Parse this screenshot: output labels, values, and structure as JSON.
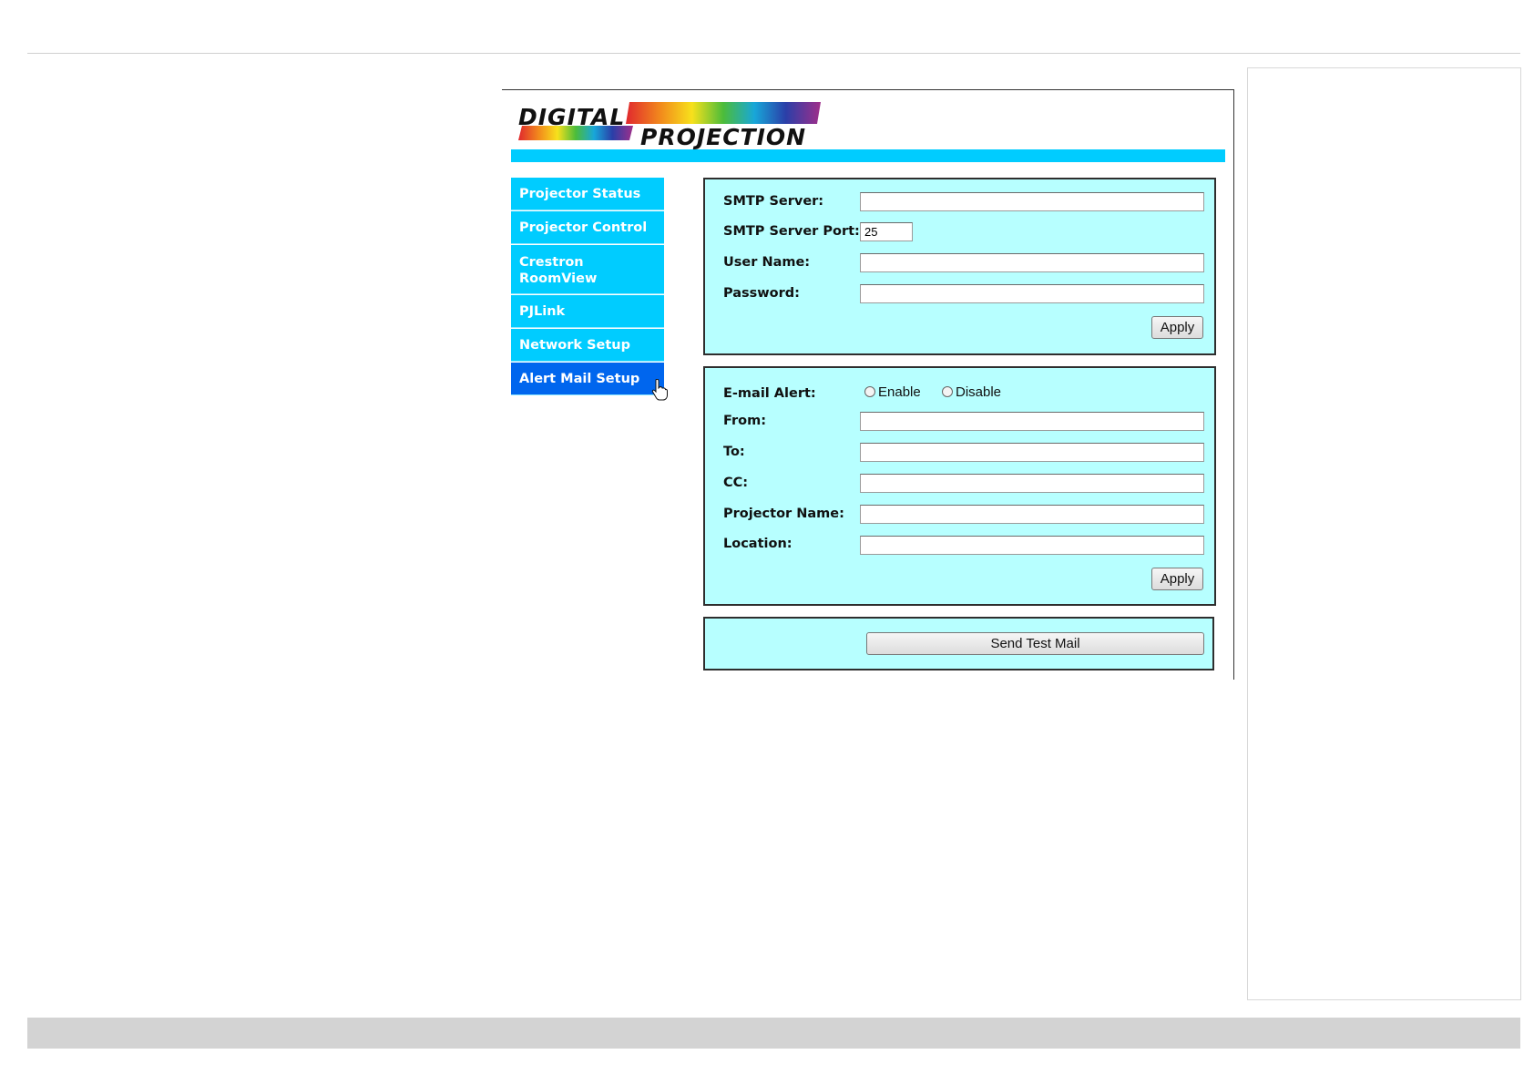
{
  "logo": {
    "line1": "DIGITAL",
    "line2": "PROJECTION"
  },
  "nav": {
    "items": [
      {
        "label": "Projector Status"
      },
      {
        "label": "Projector Control"
      },
      {
        "label": "Crestron RoomView"
      },
      {
        "label": "PJLink"
      },
      {
        "label": "Network Setup"
      },
      {
        "label": "Alert Mail Setup",
        "active": true
      }
    ]
  },
  "smtp": {
    "server_label": "SMTP Server:",
    "server_value": "",
    "port_label": "SMTP Server Port:",
    "port_value": "25",
    "user_label": "User Name:",
    "user_value": "",
    "password_label": "Password:",
    "password_value": "",
    "apply_label": "Apply"
  },
  "alert": {
    "email_alert_label": "E-mail Alert:",
    "enable_label": "Enable",
    "disable_label": "Disable",
    "from_label": "From:",
    "to_label": "To:",
    "cc_label": "CC:",
    "projector_name_label": "Projector Name:",
    "location_label": "Location:",
    "apply_label": "Apply"
  },
  "test_mail": {
    "button_label": "Send Test Mail"
  },
  "colors": {
    "nav": "#00ccff",
    "nav_active": "#0066ee",
    "panel": "#b7ffff"
  },
  "icons": {
    "cursor": "hand-pointer-icon"
  }
}
